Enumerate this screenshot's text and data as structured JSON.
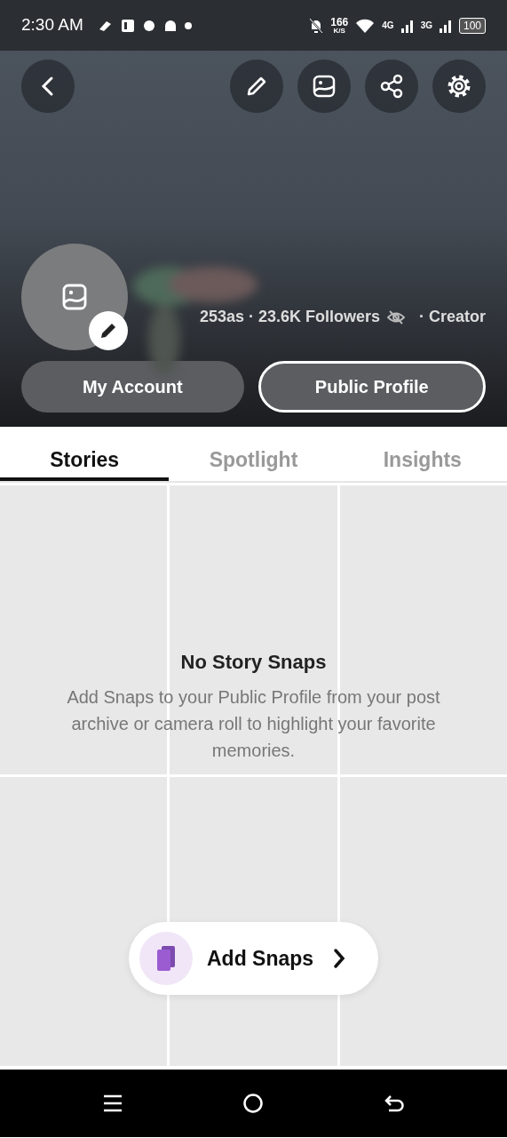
{
  "status_bar": {
    "time": "2:30 AM",
    "speed": "166",
    "speed_unit": "K/S",
    "network_1": "4G",
    "network_2": "3G",
    "battery": "100"
  },
  "profile": {
    "stats": "253as · 23.6K Followers",
    "role": "· Creator"
  },
  "buttons": [
    {
      "label": "My Account",
      "kind": "filled"
    },
    {
      "label": "Public Profile",
      "kind": "outlined"
    }
  ],
  "tabs": [
    {
      "label": "Stories",
      "selected": true
    },
    {
      "label": "Spotlight",
      "selected": false
    },
    {
      "label": "Insights",
      "selected": false
    }
  ],
  "empty_state": {
    "title": "No Story Snaps",
    "message": "Add Snaps to your Public Profile from your post archive or camera roll to highlight your favorite memories."
  },
  "add_button": {
    "label": "Add Snaps"
  }
}
